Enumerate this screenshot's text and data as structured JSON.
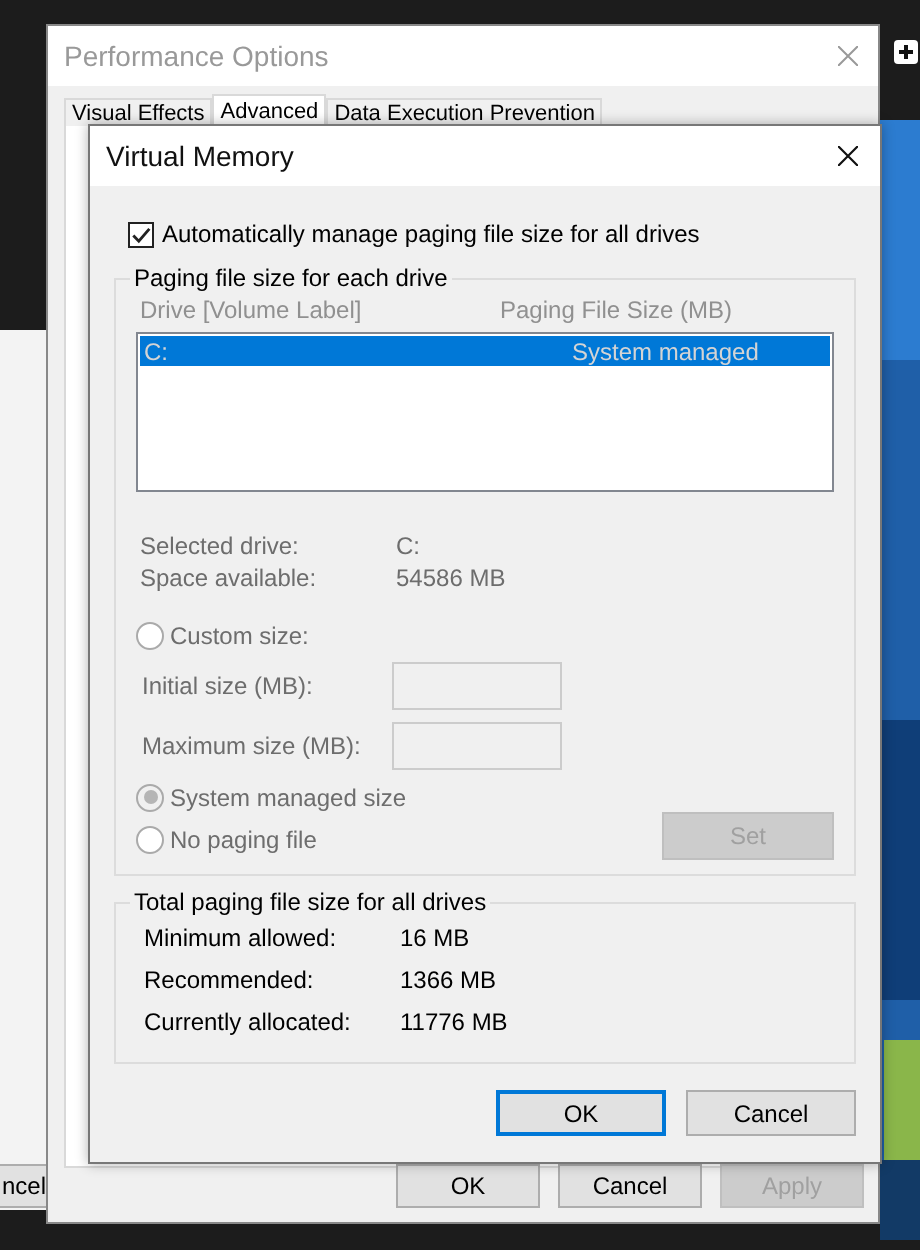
{
  "background": {
    "button_fragment": "ncel"
  },
  "window": {
    "title": "Performance Options",
    "tabs": [
      {
        "label": "Visual Effects",
        "selected": false
      },
      {
        "label": "Advanced",
        "selected": true
      },
      {
        "label": "Data Execution Prevention",
        "selected": false
      }
    ],
    "buttons": [
      {
        "label": "OK",
        "disabled": false
      },
      {
        "label": "Cancel",
        "disabled": false
      },
      {
        "label": "Apply",
        "disabled": true
      }
    ]
  },
  "dialog": {
    "title": "Virtual Memory",
    "auto_manage": {
      "label": "Automatically manage paging file size for all drives",
      "checked": true
    },
    "drives_group": {
      "title": "Paging file size for each drive",
      "disabled": true,
      "columns": [
        "Drive  [Volume Label]",
        "Paging File Size (MB)"
      ],
      "rows": [
        {
          "drive": "C:",
          "size": "System managed",
          "selected": true
        }
      ],
      "details": [
        {
          "label": "Selected drive:",
          "value": "C:"
        },
        {
          "label": "Space available:",
          "value": "54586 MB"
        }
      ],
      "options": [
        {
          "kind": "radio",
          "label": "Custom size:",
          "selected": false
        },
        {
          "kind": "field",
          "label": "Initial size (MB):"
        },
        {
          "kind": "field",
          "label": "Maximum size (MB):"
        },
        {
          "kind": "radio",
          "label": "System managed size",
          "selected": true
        },
        {
          "kind": "radio",
          "label": "No paging file",
          "selected": false
        }
      ],
      "set_button": "Set"
    },
    "totals_group": {
      "title": "Total paging file size for all drives",
      "rows": [
        {
          "label": "Minimum allowed:",
          "value": "16 MB"
        },
        {
          "label": "Recommended:",
          "value": "1366 MB"
        },
        {
          "label": "Currently allocated:",
          "value": "11776 MB"
        }
      ]
    },
    "buttons": [
      {
        "label": "OK",
        "default": true
      },
      {
        "label": "Cancel",
        "default": false
      }
    ]
  }
}
